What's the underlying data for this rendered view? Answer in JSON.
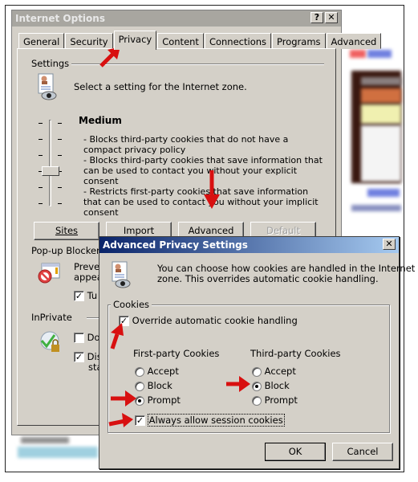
{
  "internet_options": {
    "title": "Internet Options",
    "help_button": "?",
    "close_button": "✕",
    "tabs": [
      {
        "label": "General",
        "active": false
      },
      {
        "label": "Security",
        "active": false
      },
      {
        "label": "Privacy",
        "active": true
      },
      {
        "label": "Content",
        "active": false
      },
      {
        "label": "Connections",
        "active": false
      },
      {
        "label": "Programs",
        "active": false
      },
      {
        "label": "Advanced",
        "active": false
      }
    ],
    "settings": {
      "group_label": "Settings",
      "intro": "Select a setting for the Internet zone.",
      "level": "Medium",
      "slider_level": "Medium (3 of 6)",
      "description": [
        "- Blocks third-party cookies that do not have a compact privacy policy",
        "- Blocks third-party cookies that save information that can be used to contact you without your explicit consent",
        "- Restricts first-party cookies that save information that can be used to contact you without your implicit consent"
      ],
      "buttons": {
        "sites": "Sites",
        "import": "Import",
        "advanced": "Advanced",
        "default": "Default"
      }
    },
    "popup_blocker": {
      "group_label": "Pop-up Blocker",
      "text_partial": "Prever",
      "text_partial2": "appea",
      "turn_on_partial": "Tu",
      "turn_on_checked": true
    },
    "inprivate": {
      "group_label": "InPrivate",
      "opt1_partial": "Do",
      "opt1_checked": false,
      "opt2_partial": "Dis",
      "opt2_partial2": "sta",
      "opt2_checked": true
    }
  },
  "advanced_privacy": {
    "title": "Advanced Privacy Settings",
    "close_button": "✕",
    "intro_line1": "You can choose how cookies are handled in the Internet",
    "intro_line2": "zone.  This overrides automatic cookie handling.",
    "cookies_group": "Cookies",
    "override_label": "Override automatic cookie handling",
    "override_checked": true,
    "first_party": {
      "label": "First-party Cookies",
      "options": [
        "Accept",
        "Block",
        "Prompt"
      ],
      "selected": "Prompt"
    },
    "third_party": {
      "label": "Third-party Cookies",
      "options": [
        "Accept",
        "Block",
        "Prompt"
      ],
      "selected": "Block"
    },
    "session_label": "Always allow session cookies",
    "session_checked": true,
    "ok": "OK",
    "cancel": "Cancel"
  },
  "colors": {
    "dialog_bg": "#d4d0c8",
    "active_title": "#0a246a",
    "inactive_title": "#a8a6a0",
    "annotation_arrow": "#d81010"
  }
}
